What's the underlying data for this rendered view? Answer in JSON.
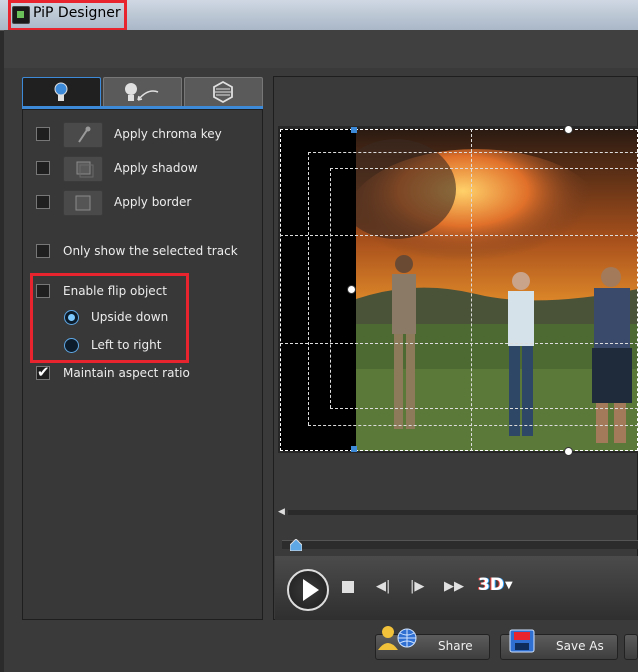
{
  "window": {
    "title": "PiP Designer"
  },
  "tabs": [
    {
      "icon": "lightbulb-icon",
      "active": true
    },
    {
      "icon": "lightbulb-motion-icon",
      "active": false
    },
    {
      "icon": "hexagon-mask-icon",
      "active": false
    }
  ],
  "options": {
    "chroma_key_label": "Apply chroma key",
    "shadow_label": "Apply shadow",
    "border_label": "Apply border",
    "selected_track_label": "Only show the selected track",
    "flip_label": "Enable flip object",
    "upside_down_label": "Upside down",
    "left_right_label": "Left to right",
    "aspect_label": "Maintain aspect ratio",
    "chroma_key_checked": false,
    "shadow_checked": false,
    "border_checked": false,
    "selected_track_checked": false,
    "flip_checked": false,
    "aspect_checked": true,
    "flip_direction": "Upside down"
  },
  "player": {
    "three_d_label": "3D",
    "seek_position": 0.02
  },
  "bottom": {
    "share_label": "Share",
    "save_as_label": "Save As"
  },
  "colors": {
    "accent": "#3d8ad8",
    "highlight": "#e8242f"
  }
}
